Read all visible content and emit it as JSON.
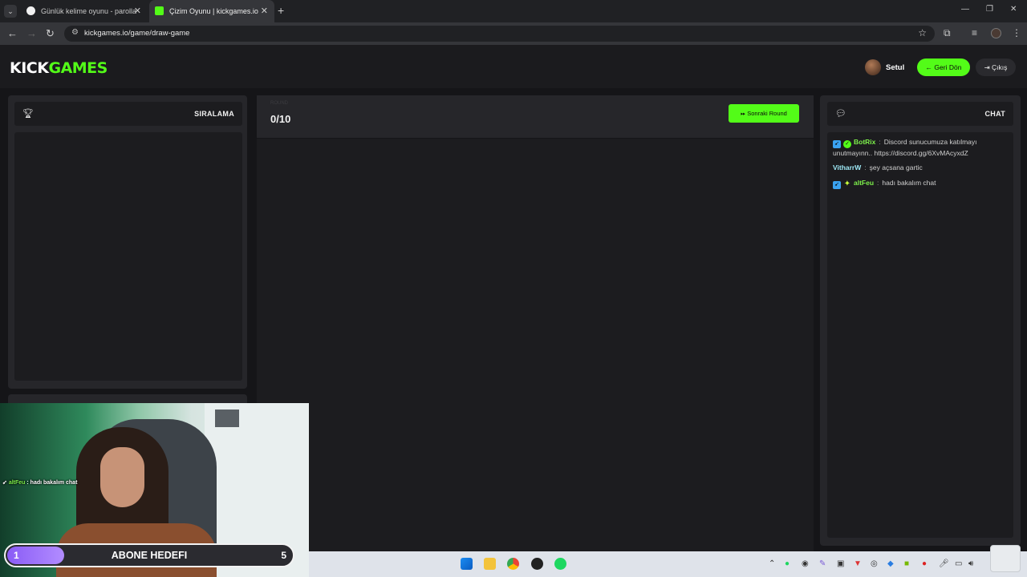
{
  "browser": {
    "tabs": [
      {
        "title": "Günlük kelime oyunu - parolla",
        "active": false
      },
      {
        "title": "Çizim Oyunu | kickgames.io",
        "active": true
      }
    ],
    "url": "kickgames.io/game/draw-game"
  },
  "header": {
    "logo_part1": "KICK",
    "logo_part2": "GAMES",
    "username": "Setul",
    "back_label": "Geri Dön",
    "exit_label": "Çıkış"
  },
  "leaderboard": {
    "title": "SIRALAMA"
  },
  "game": {
    "faint_label": "ROUND",
    "round": "0/10",
    "next_round_label": "Sonraki Round"
  },
  "chat": {
    "title": "CHAT",
    "messages": [
      {
        "user": "BotRix",
        "text": "Discord sunucumuza katılmayı unutmayınn.. https://discord.gg/6XvMAcyxdZ"
      },
      {
        "user": "VitharrW",
        "text": "şey açsana gartic"
      },
      {
        "user": "altFeu",
        "text": "hadı bakalım chat"
      }
    ]
  },
  "stream_overlay": {
    "chat_user": "altFeu",
    "chat_text": ": hadı bakalım chat",
    "goal_current": "1",
    "goal_label": "ABONE HEDEFI",
    "goal_target": "5",
    "goal_progress": 0.2
  },
  "colors": {
    "accent": "#53fc18",
    "background": "#151518",
    "panel": "#26262a",
    "goal_fill": "#8a5cf6"
  }
}
